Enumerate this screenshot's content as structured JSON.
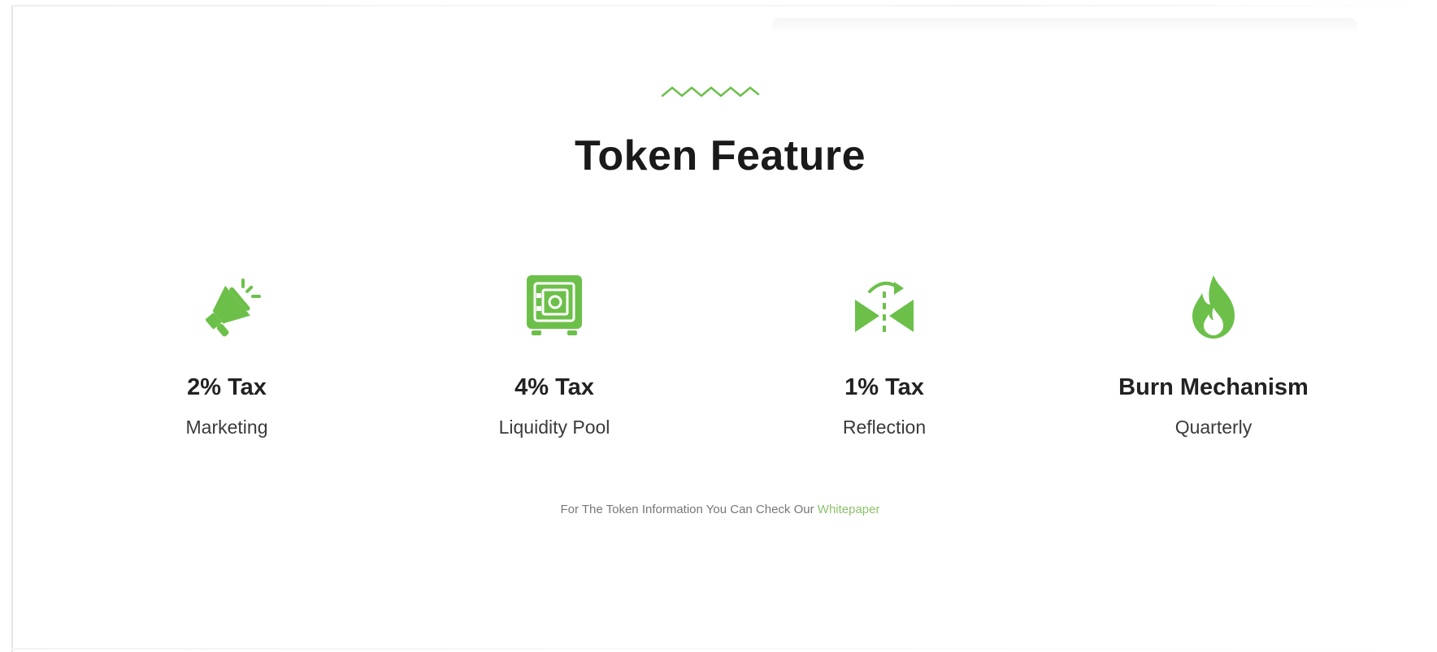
{
  "section": {
    "title": "Token Feature",
    "accent_color": "#6cc04a"
  },
  "features": [
    {
      "icon": "megaphone-icon",
      "heading": "2% Tax",
      "sub": "Marketing"
    },
    {
      "icon": "safe-icon",
      "heading": "4% Tax",
      "sub": "Liquidity Pool"
    },
    {
      "icon": "reflection-icon",
      "heading": "1% Tax",
      "sub": "Reflection"
    },
    {
      "icon": "flame-icon",
      "heading": "Burn Mechanism",
      "sub": "Quarterly"
    }
  ],
  "footnote": {
    "text": "For The Token Information You Can Check Our ",
    "link_label": "Whitepaper"
  }
}
